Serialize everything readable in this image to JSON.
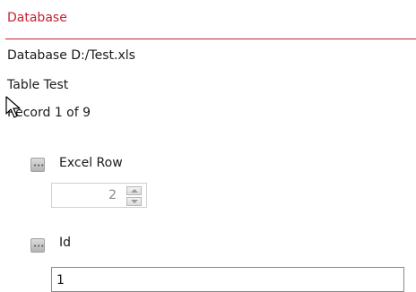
{
  "section": {
    "title": "Database"
  },
  "info": {
    "database": "Database D:/Test.xls",
    "table": "Table Test",
    "record": "Record 1 of 9"
  },
  "fields": {
    "excel_row": {
      "button_icon": "ellipsis-icon",
      "label": "Excel Row",
      "value": "2"
    },
    "id": {
      "button_icon": "ellipsis-icon",
      "label": "Id",
      "value": "1"
    }
  },
  "colors": {
    "accent": "#c8202f"
  }
}
